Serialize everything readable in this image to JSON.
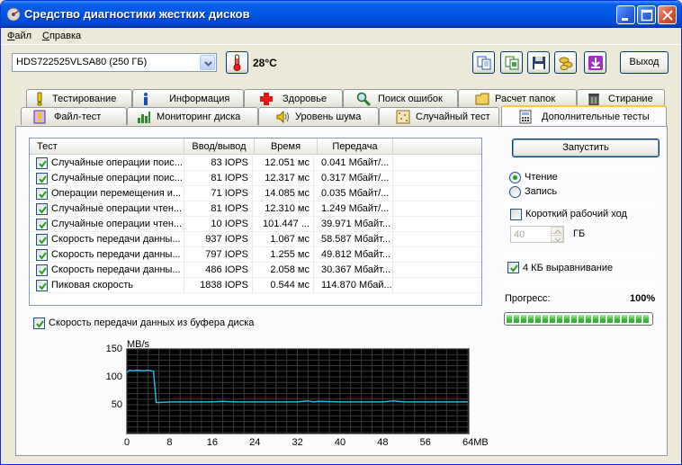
{
  "window": {
    "title": "Средство диагностики жестких дисков"
  },
  "menu": {
    "file_rest": "айл",
    "file_accel": "Ф",
    "help_rest": "правка",
    "help_accel": "С"
  },
  "toolbar": {
    "drive": "HDS722525VLSA80 (250 ГБ)",
    "temperature": "28°C",
    "exit_label": "Выход",
    "icons": [
      "copy-icon",
      "copy-alt-icon",
      "save-icon",
      "coins-icon",
      "download-icon"
    ]
  },
  "tabs": {
    "row1": [
      "Тестирование",
      "Информация",
      "Здоровье",
      "Поиск ошибок",
      "Расчет папок",
      "Стирание"
    ],
    "row2": [
      "Файл-тест",
      "Мониторинг диска",
      "Уровень шума",
      "Случайный тест",
      "Дополнительные тесты"
    ],
    "active": "Дополнительные тесты"
  },
  "table": {
    "headers": [
      "Тест",
      "Ввод/вывод",
      "Время",
      "Передача"
    ],
    "rows": [
      {
        "checked": true,
        "test": "Случайные операции поис...",
        "io": "83 IOPS",
        "time": "12.051 мс",
        "transfer": "0.041 Мбайт/..."
      },
      {
        "checked": true,
        "test": "Случайные операции поис...",
        "io": "81 IOPS",
        "time": "12.317 мс",
        "transfer": "0.317 Мбайт/..."
      },
      {
        "checked": true,
        "test": "Операции перемещения и...",
        "io": "71 IOPS",
        "time": "14.085 мс",
        "transfer": "0.035 Мбайт/..."
      },
      {
        "checked": true,
        "test": "Случайные операции чтен...",
        "io": "81 IOPS",
        "time": "12.310 мс",
        "transfer": "1.249 Мбайт/..."
      },
      {
        "checked": true,
        "test": "Случайные операции чтен...",
        "io": "10 IOPS",
        "time": "101.447 ...",
        "transfer": "39.971 Мбайт..."
      },
      {
        "checked": true,
        "test": "Скорость передачи данны...",
        "io": "937 IOPS",
        "time": "1.067 мс",
        "transfer": "58.587 Мбайт..."
      },
      {
        "checked": true,
        "test": "Скорость передачи данны...",
        "io": "797 IOPS",
        "time": "1.255 мс",
        "transfer": "49.812 Мбайт..."
      },
      {
        "checked": true,
        "test": "Скорость передачи данны...",
        "io": "486 IOPS",
        "time": "2.058 мс",
        "transfer": "30.367 Мбайт..."
      },
      {
        "checked": true,
        "test": "Пиковая скорость",
        "io": "1838 IOPS",
        "time": "0.544 мс",
        "transfer": "114.870 Мбай..."
      }
    ]
  },
  "options": {
    "run_label": "Запустить",
    "read_label": "Чтение",
    "write_label": "Запись",
    "mode": "read",
    "short_stroke_label": "Короткий рабочий ход",
    "short_stroke_checked": false,
    "short_stroke_value": "40",
    "short_stroke_unit": "ГБ",
    "align_label": "4 КБ выравнивание",
    "align_checked": true,
    "progress_label": "Прогресс:",
    "progress_value": "100%",
    "progress_fraction": 1.0
  },
  "buffer_check": {
    "label": "Скорость передачи данных из буфера диска",
    "checked": true
  },
  "chart_data": {
    "type": "line",
    "ylabel": "MB/s",
    "xunit": "MB",
    "ylim": [
      0,
      150
    ],
    "xlim": [
      0,
      64
    ],
    "yticks": [
      150,
      100,
      50
    ],
    "xticks": [
      0,
      8,
      16,
      24,
      32,
      40,
      48,
      56,
      64
    ],
    "line_color": "#28B4E6",
    "grid": true,
    "series": [
      {
        "x": [
          0,
          0.5,
          1,
          2,
          3,
          4,
          5,
          5.5,
          6,
          8,
          12,
          16,
          18,
          20,
          24,
          28,
          32,
          34,
          35,
          36,
          40,
          44,
          48,
          50,
          52,
          56,
          60,
          64
        ],
        "y": [
          108,
          112,
          111,
          112,
          111,
          112,
          110,
          54,
          54,
          55,
          55,
          55,
          56,
          55,
          55,
          55,
          55,
          57,
          55,
          56,
          55,
          55,
          55,
          57,
          55,
          55,
          55,
          55
        ]
      }
    ]
  }
}
